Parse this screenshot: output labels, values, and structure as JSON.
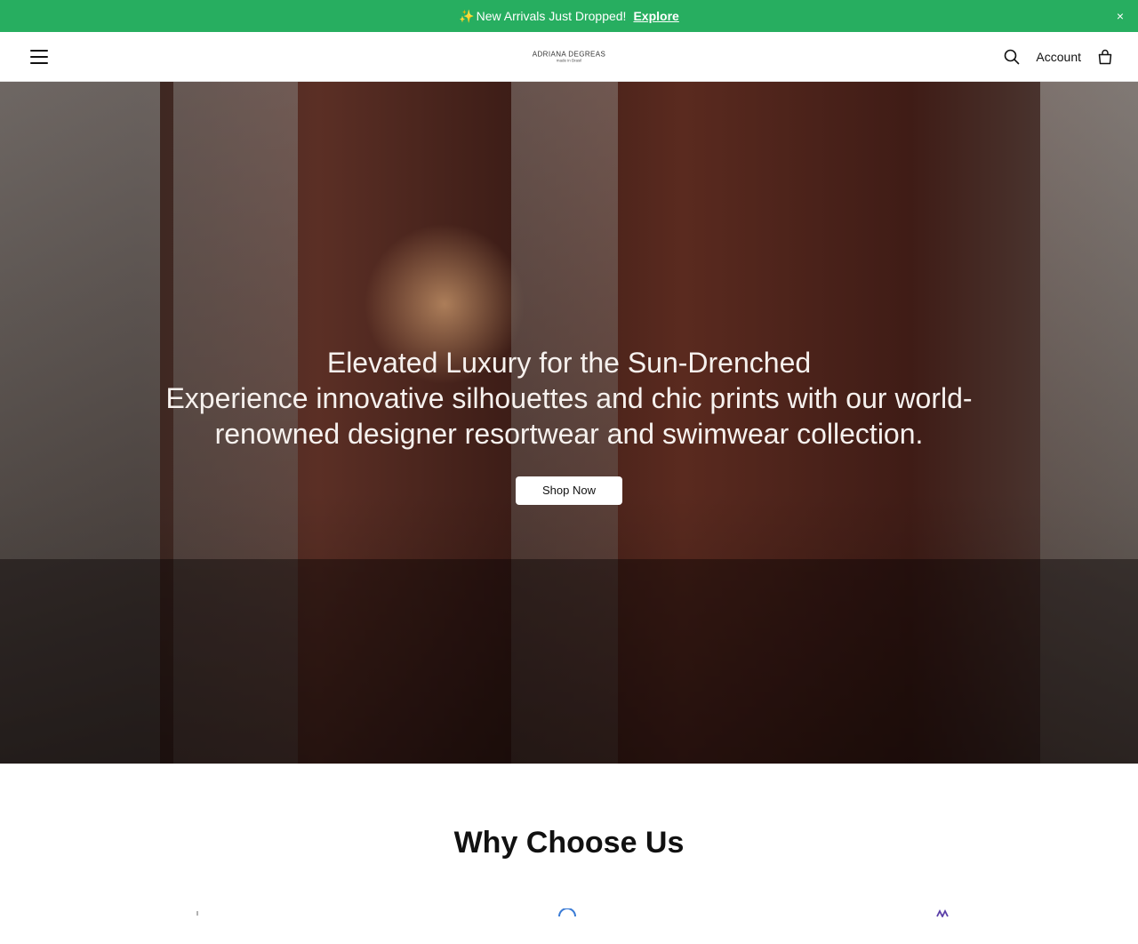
{
  "announcement": {
    "sparkle": "✨",
    "text": "New Arrivals Just Dropped!",
    "link_label": "Explore",
    "close": "×"
  },
  "header": {
    "brand_line1": "ADRIANA DEGREAS",
    "brand_line2": "made in Brasil",
    "account_label": "Account",
    "icons": [
      "menu-icon",
      "search-icon",
      "bag-icon"
    ]
  },
  "hero": {
    "title": "Elevated Luxury for the Sun-Drenched",
    "subtitle": "Experience innovative silhouettes and chic prints with our world-renowned designer resortwear and swimwear collection.",
    "cta_label": "Shop Now"
  },
  "why": {
    "title": "Why Choose Us"
  },
  "colors": {
    "announcement_bg": "#27ae60",
    "text": "#111111",
    "button_bg": "#ffffff"
  }
}
